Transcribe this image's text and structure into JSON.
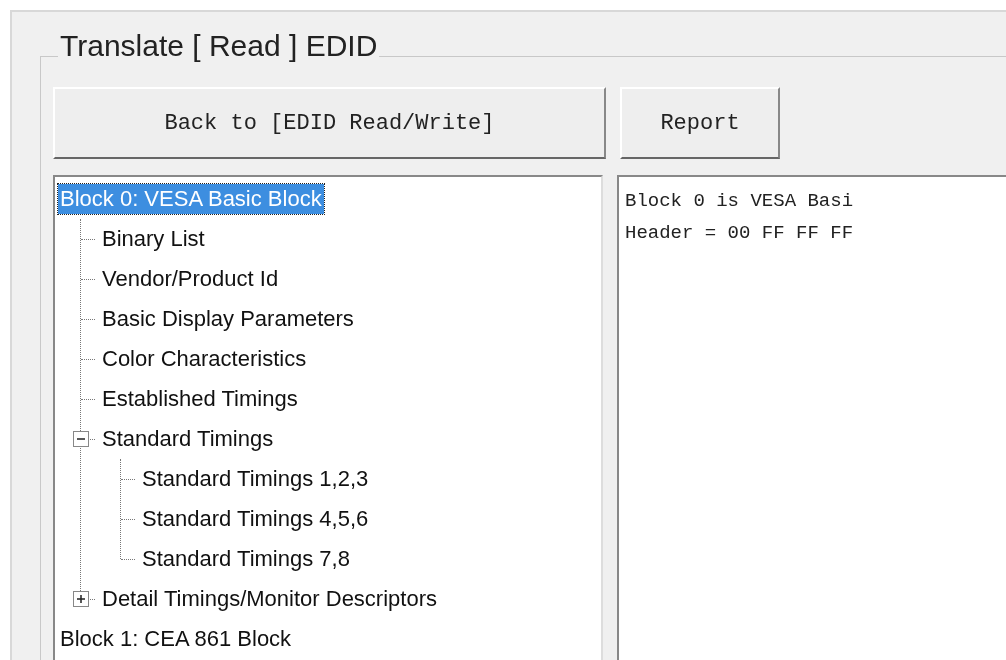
{
  "group": {
    "title": "Translate [ Read ] EDID"
  },
  "buttons": [
    "Back to [EDID Read/Write]",
    "Report"
  ],
  "tree": [
    {
      "label": "Block 0: VESA Basic Block",
      "selected": true,
      "children": [
        {
          "label": "Binary List",
          "selected": false
        },
        {
          "label": "Vendor/Product Id",
          "selected": false
        },
        {
          "label": "Basic Display Parameters",
          "selected": false
        },
        {
          "label": "Color Characteristics",
          "selected": false
        },
        {
          "label": "Established Timings",
          "selected": false
        },
        {
          "label": "Standard Timings",
          "selected": false,
          "expanded": true,
          "children": [
            {
              "label": "Standard Timings 1,2,3",
              "selected": false
            },
            {
              "label": "Standard Timings 4,5,6",
              "selected": false
            },
            {
              "label": "Standard Timings 7,8",
              "selected": false
            }
          ]
        },
        {
          "label": "Detail Timings/Monitor Descriptors",
          "selected": false,
          "expanded": false
        }
      ]
    },
    {
      "label": "Block 1: CEA 861 Block",
      "selected": false
    }
  ],
  "report": [
    "Block 0 is VESA Basi",
    "Header = 00 FF FF FF"
  ]
}
